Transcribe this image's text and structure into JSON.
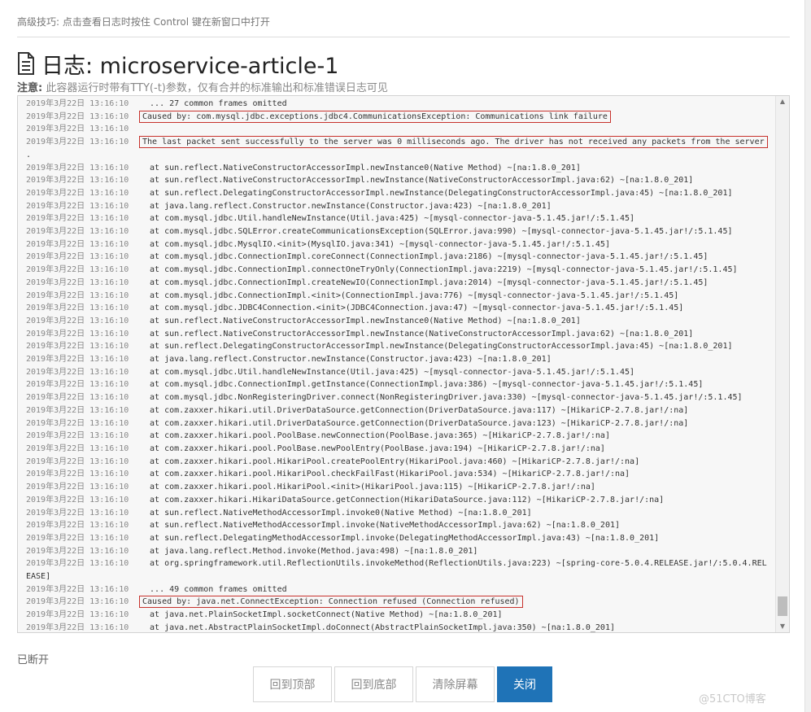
{
  "tip": "高级技巧: 点击查看日志时按住 Control 键在新窗口中打开",
  "title": "日志: microservice-article-1",
  "note_label": "注意:",
  "note_text": " 此容器运行时带有TTY(-t)参数，仅有合并的标准输出和标准错误日志可见",
  "status": "已断开",
  "buttons": {
    "top": "回到顶部",
    "bottom": "回到底部",
    "clear": "清除屏幕",
    "close": "关闭"
  },
  "watermark": "@51CTO博客",
  "log_lines": [
    {
      "ts": "2019年3月22日 13:16:10",
      "msg": "  ... 27 common frames omitted"
    },
    {
      "ts": "2019年3月22日 13:16:10",
      "msg": "Caused by: com.mysql.jdbc.exceptions.jdbc4.CommunicationsException: Communications link failure",
      "highlight": true
    },
    {
      "ts": "2019年3月22日 13:16:10",
      "msg": ""
    },
    {
      "ts": "2019年3月22日 13:16:10",
      "msg": "The last packet sent successfully to the server was 0 milliseconds ago. The driver has not received any packets from the server",
      "highlight": true
    },
    {
      "ts": "",
      "msg": "."
    },
    {
      "ts": "2019年3月22日 13:16:10",
      "msg": "  at sun.reflect.NativeConstructorAccessorImpl.newInstance0(Native Method) ~[na:1.8.0_201]"
    },
    {
      "ts": "2019年3月22日 13:16:10",
      "msg": "  at sun.reflect.NativeConstructorAccessorImpl.newInstance(NativeConstructorAccessorImpl.java:62) ~[na:1.8.0_201]"
    },
    {
      "ts": "2019年3月22日 13:16:10",
      "msg": "  at sun.reflect.DelegatingConstructorAccessorImpl.newInstance(DelegatingConstructorAccessorImpl.java:45) ~[na:1.8.0_201]"
    },
    {
      "ts": "2019年3月22日 13:16:10",
      "msg": "  at java.lang.reflect.Constructor.newInstance(Constructor.java:423) ~[na:1.8.0_201]"
    },
    {
      "ts": "2019年3月22日 13:16:10",
      "msg": "  at com.mysql.jdbc.Util.handleNewInstance(Util.java:425) ~[mysql-connector-java-5.1.45.jar!/:5.1.45]"
    },
    {
      "ts": "2019年3月22日 13:16:10",
      "msg": "  at com.mysql.jdbc.SQLError.createCommunicationsException(SQLError.java:990) ~[mysql-connector-java-5.1.45.jar!/:5.1.45]"
    },
    {
      "ts": "2019年3月22日 13:16:10",
      "msg": "  at com.mysql.jdbc.MysqlIO.<init>(MysqlIO.java:341) ~[mysql-connector-java-5.1.45.jar!/:5.1.45]"
    },
    {
      "ts": "2019年3月22日 13:16:10",
      "msg": "  at com.mysql.jdbc.ConnectionImpl.coreConnect(ConnectionImpl.java:2186) ~[mysql-connector-java-5.1.45.jar!/:5.1.45]"
    },
    {
      "ts": "2019年3月22日 13:16:10",
      "msg": "  at com.mysql.jdbc.ConnectionImpl.connectOneTryOnly(ConnectionImpl.java:2219) ~[mysql-connector-java-5.1.45.jar!/:5.1.45]"
    },
    {
      "ts": "2019年3月22日 13:16:10",
      "msg": "  at com.mysql.jdbc.ConnectionImpl.createNewIO(ConnectionImpl.java:2014) ~[mysql-connector-java-5.1.45.jar!/:5.1.45]"
    },
    {
      "ts": "2019年3月22日 13:16:10",
      "msg": "  at com.mysql.jdbc.ConnectionImpl.<init>(ConnectionImpl.java:776) ~[mysql-connector-java-5.1.45.jar!/:5.1.45]"
    },
    {
      "ts": "2019年3月22日 13:16:10",
      "msg": "  at com.mysql.jdbc.JDBC4Connection.<init>(JDBC4Connection.java:47) ~[mysql-connector-java-5.1.45.jar!/:5.1.45]"
    },
    {
      "ts": "2019年3月22日 13:16:10",
      "msg": "  at sun.reflect.NativeConstructorAccessorImpl.newInstance0(Native Method) ~[na:1.8.0_201]"
    },
    {
      "ts": "2019年3月22日 13:16:10",
      "msg": "  at sun.reflect.NativeConstructorAccessorImpl.newInstance(NativeConstructorAccessorImpl.java:62) ~[na:1.8.0_201]"
    },
    {
      "ts": "2019年3月22日 13:16:10",
      "msg": "  at sun.reflect.DelegatingConstructorAccessorImpl.newInstance(DelegatingConstructorAccessorImpl.java:45) ~[na:1.8.0_201]"
    },
    {
      "ts": "2019年3月22日 13:16:10",
      "msg": "  at java.lang.reflect.Constructor.newInstance(Constructor.java:423) ~[na:1.8.0_201]"
    },
    {
      "ts": "2019年3月22日 13:16:10",
      "msg": "  at com.mysql.jdbc.Util.handleNewInstance(Util.java:425) ~[mysql-connector-java-5.1.45.jar!/:5.1.45]"
    },
    {
      "ts": "2019年3月22日 13:16:10",
      "msg": "  at com.mysql.jdbc.ConnectionImpl.getInstance(ConnectionImpl.java:386) ~[mysql-connector-java-5.1.45.jar!/:5.1.45]"
    },
    {
      "ts": "2019年3月22日 13:16:10",
      "msg": "  at com.mysql.jdbc.NonRegisteringDriver.connect(NonRegisteringDriver.java:330) ~[mysql-connector-java-5.1.45.jar!/:5.1.45]"
    },
    {
      "ts": "2019年3月22日 13:16:10",
      "msg": "  at com.zaxxer.hikari.util.DriverDataSource.getConnection(DriverDataSource.java:117) ~[HikariCP-2.7.8.jar!/:na]"
    },
    {
      "ts": "2019年3月22日 13:16:10",
      "msg": "  at com.zaxxer.hikari.util.DriverDataSource.getConnection(DriverDataSource.java:123) ~[HikariCP-2.7.8.jar!/:na]"
    },
    {
      "ts": "2019年3月22日 13:16:10",
      "msg": "  at com.zaxxer.hikari.pool.PoolBase.newConnection(PoolBase.java:365) ~[HikariCP-2.7.8.jar!/:na]"
    },
    {
      "ts": "2019年3月22日 13:16:10",
      "msg": "  at com.zaxxer.hikari.pool.PoolBase.newPoolEntry(PoolBase.java:194) ~[HikariCP-2.7.8.jar!/:na]"
    },
    {
      "ts": "2019年3月22日 13:16:10",
      "msg": "  at com.zaxxer.hikari.pool.HikariPool.createPoolEntry(HikariPool.java:460) ~[HikariCP-2.7.8.jar!/:na]"
    },
    {
      "ts": "2019年3月22日 13:16:10",
      "msg": "  at com.zaxxer.hikari.pool.HikariPool.checkFailFast(HikariPool.java:534) ~[HikariCP-2.7.8.jar!/:na]"
    },
    {
      "ts": "2019年3月22日 13:16:10",
      "msg": "  at com.zaxxer.hikari.pool.HikariPool.<init>(HikariPool.java:115) ~[HikariCP-2.7.8.jar!/:na]"
    },
    {
      "ts": "2019年3月22日 13:16:10",
      "msg": "  at com.zaxxer.hikari.HikariDataSource.getConnection(HikariDataSource.java:112) ~[HikariCP-2.7.8.jar!/:na]"
    },
    {
      "ts": "2019年3月22日 13:16:10",
      "msg": "  at sun.reflect.NativeMethodAccessorImpl.invoke0(Native Method) ~[na:1.8.0_201]"
    },
    {
      "ts": "2019年3月22日 13:16:10",
      "msg": "  at sun.reflect.NativeMethodAccessorImpl.invoke(NativeMethodAccessorImpl.java:62) ~[na:1.8.0_201]"
    },
    {
      "ts": "2019年3月22日 13:16:10",
      "msg": "  at sun.reflect.DelegatingMethodAccessorImpl.invoke(DelegatingMethodAccessorImpl.java:43) ~[na:1.8.0_201]"
    },
    {
      "ts": "2019年3月22日 13:16:10",
      "msg": "  at java.lang.reflect.Method.invoke(Method.java:498) ~[na:1.8.0_201]"
    },
    {
      "ts": "2019年3月22日 13:16:10",
      "msg": "  at org.springframework.util.ReflectionUtils.invokeMethod(ReflectionUtils.java:223) ~[spring-core-5.0.4.RELEASE.jar!/:5.0.4.REL"
    },
    {
      "ts": "",
      "msg": "EASE]"
    },
    {
      "ts": "2019年3月22日 13:16:10",
      "msg": "  ... 49 common frames omitted"
    },
    {
      "ts": "2019年3月22日 13:16:10",
      "msg": "Caused by: java.net.ConnectException: Connection refused (Connection refused)",
      "highlight": true
    },
    {
      "ts": "2019年3月22日 13:16:10",
      "msg": "  at java.net.PlainSocketImpl.socketConnect(Native Method) ~[na:1.8.0_201]"
    },
    {
      "ts": "2019年3月22日 13:16:10",
      "msg": "  at java.net.AbstractPlainSocketImpl.doConnect(AbstractPlainSocketImpl.java:350) ~[na:1.8.0_201]"
    }
  ]
}
